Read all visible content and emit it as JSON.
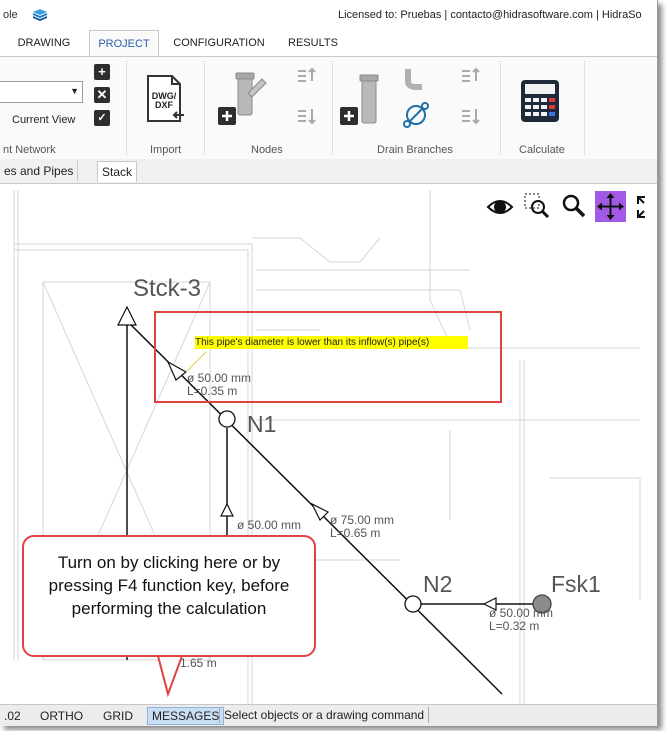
{
  "title_bar": {
    "app_name_fragment": "ole",
    "license": "Licensed to: Pruebas | contacto@hidrasoftware.com | HidraSo"
  },
  "tabs": [
    {
      "label": "DRAWING",
      "active": false
    },
    {
      "label": "PROJECT",
      "active": true
    },
    {
      "label": "CONFIGURATION",
      "active": false
    },
    {
      "label": "RESULTS",
      "active": false
    }
  ],
  "ribbon": {
    "network_group": {
      "combo_value": "",
      "current_view_label": "Current View",
      "label": "nt Network"
    },
    "import_group": {
      "dwg_line1": "DWG/",
      "dwg_line2": "DXF",
      "label": "Import"
    },
    "nodes_group": {
      "label": "Nodes"
    },
    "drain_group": {
      "label": "Drain Branches"
    },
    "calculate_group": {
      "label": "Calculate"
    }
  },
  "doc_tabs": [
    {
      "label": "es and Pipes"
    },
    {
      "label": "Stack"
    }
  ],
  "drawing": {
    "stack_label": "Stck-3",
    "warning": "This pipe's diameter is lower than its inflow(s) pipe(s)",
    "pipe_a_dia": "ø 50.00 mm",
    "pipe_a_len": "L=0.35 m",
    "node_n1": "N1",
    "node_n2": "N2",
    "fixture_fsk1": "Fsk1",
    "pipe_b_dia": "ø 50.00 mm",
    "pipe_c_dia": "ø 75.00 mm",
    "pipe_c_len": "L=0.65 m",
    "pipe_d_dia": "ø 50.00 mm",
    "pipe_d_len": "L=0.32 m",
    "pipe_e_len": "1.65 m"
  },
  "callout": {
    "text": "Turn on by clicking here or by pressing F4 function key, before performing the calculation"
  },
  "status_bar": {
    "coord": ".02",
    "ortho": "ORTHO",
    "grid": "GRID",
    "messages": "MESSAGES",
    "command": "Select objects or a drawing command"
  },
  "colors": {
    "accent": "#2a60a8",
    "callout_border": "#e0423f",
    "warning_bg": "#ffff00",
    "pan_tool_bg": "#a259e6",
    "messages_bg": "#c9def3"
  }
}
